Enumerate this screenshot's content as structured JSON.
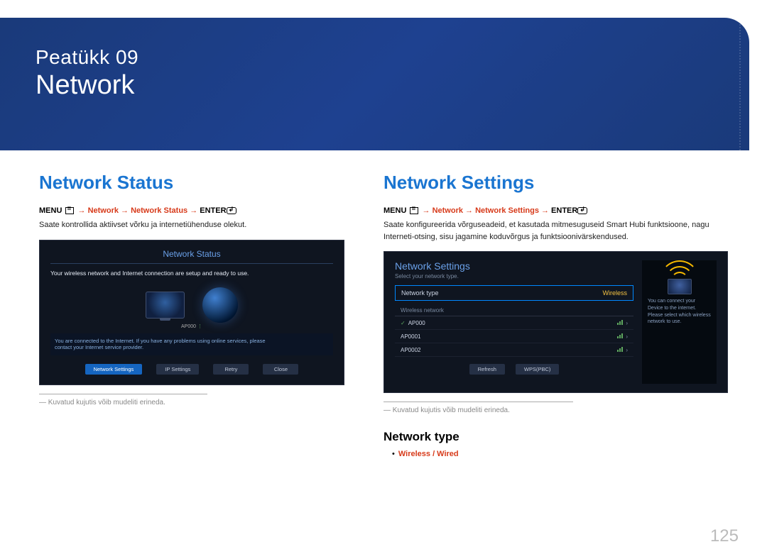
{
  "header": {
    "chapter_label": "Peatükk  09",
    "chapter_title": "Network"
  },
  "left": {
    "title": "Network Status",
    "menu_prefix": "MENU ",
    "menu_path": "→ Network → Network Status → ",
    "menu_suffix": "ENTER",
    "desc": "Saate kontrollida aktiivset võrku ja internetiühenduse olekut.",
    "ss": {
      "title": "Network Status",
      "msg": "Your wireless network and Internet connection are setup and ready to use.",
      "ap": "AP000",
      "info1": "You are connected to the Internet. If you have any problems using online services, please",
      "info2": "contact your Internet service provider.",
      "btn1": "Network Settings",
      "btn2": "IP Settings",
      "btn3": "Retry",
      "btn4": "Close"
    },
    "caption": "― Kuvatud kujutis võib mudeliti erineda."
  },
  "right": {
    "title": "Network Settings",
    "menu_prefix": "MENU ",
    "menu_path": "→ Network → Network Settings → ",
    "menu_suffix": "ENTER",
    "desc": "Saate konfigureerida võrguseadeid, et kasutada mitmesuguseid Smart Hubi funktsioone, nagu Interneti-otsing, sisu jagamine koduvõrgus ja funktsioonivärskendused.",
    "ss": {
      "title": "Network Settings",
      "sub": "Select your network type.",
      "sel_label": "Network type",
      "sel_value": "Wireless",
      "list_title": "Wireless network",
      "item1": "AP000",
      "item2": "AP0001",
      "item3": "AP0002",
      "btn1": "Refresh",
      "btn2": "WPS(PBC)",
      "side1": "You can connect your",
      "side2": "Device to the internet.",
      "side3": "Please select which wireless",
      "side4": "network to use."
    },
    "caption": "― Kuvatud kujutis võib mudeliti erineda.",
    "sub_title": "Network type",
    "option": "Wireless / Wired"
  },
  "page_number": "125"
}
